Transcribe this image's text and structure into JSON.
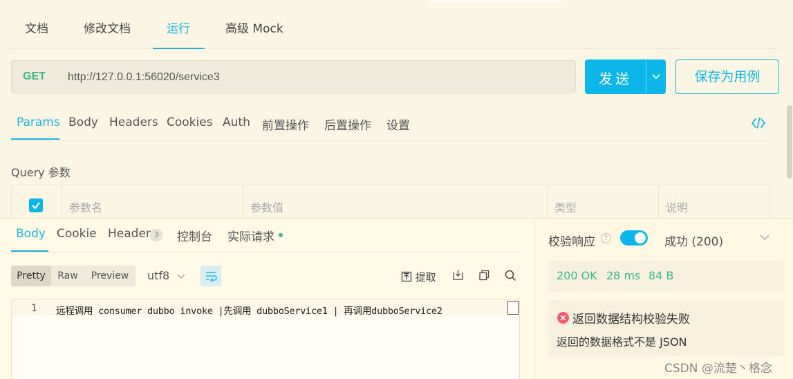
{
  "top_tabs": [
    "文档",
    "修改文档",
    "运行",
    "高级 Mock"
  ],
  "request": {
    "method": "GET",
    "url": "http://127.0.0.1:56020/service3",
    "send_label": "发送",
    "save_label": "保存为用例"
  },
  "param_tabs": [
    "Params",
    "Body",
    "Headers",
    "Cookies",
    "Auth",
    "前置操作",
    "后置操作",
    "设置"
  ],
  "query": {
    "title": "Query 参数",
    "columns": [
      "参数名",
      "参数值",
      "类型",
      "说明"
    ]
  },
  "response": {
    "tabs": [
      "Body",
      "Cookie",
      "Header",
      "控制台",
      "实际请求"
    ],
    "header_count": "3",
    "views": [
      "Pretty",
      "Raw",
      "Preview"
    ],
    "encoding": "utf8",
    "extract_label": "提取",
    "line_number": "1",
    "body_line": "远程调用 consumer dubbo invoke |先调用 dubboService1 | 再调用dubboService2"
  },
  "validation": {
    "label": "校验响应",
    "status": "成功 (200)",
    "stats": {
      "code": "200 OK",
      "time": "28 ms",
      "size": "84 B"
    },
    "error_title": "返回数据结构校验失败",
    "error_message": "返回的数据格式不是 JSON"
  },
  "watermark": "CSDN @流楚丶格念",
  "colors": {
    "accent": "#0db6e9",
    "success": "#3cb988",
    "error": "#f35b6d"
  }
}
